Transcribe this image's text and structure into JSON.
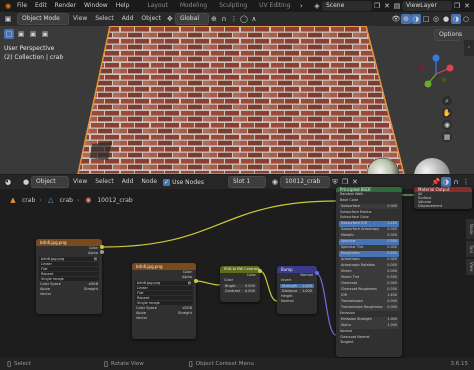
{
  "menubar": {
    "items": [
      "File",
      "Edit",
      "Render",
      "Window",
      "Help"
    ],
    "workspace_tabs": [
      "Layout",
      "Modeling",
      "Sculpting",
      "UV Editing"
    ],
    "active_tab_index": 3,
    "scene": "Scene",
    "view_layer": "ViewLayer"
  },
  "viewport": {
    "mode": "Object Mode",
    "menu": [
      "View",
      "Select",
      "Add",
      "Object"
    ],
    "orientation": "Global",
    "options_label": "Options",
    "overlay_line1": "User Perspective",
    "overlay_line2": "(2) Collection | crab"
  },
  "node_editor": {
    "editor_type": "Object",
    "menu": [
      "View",
      "Select",
      "Add",
      "Node"
    ],
    "use_nodes_label": "Use Nodes",
    "use_nodes": true,
    "slot": "Slot 1",
    "material": "10012_crab",
    "breadcrumb": [
      "crab",
      "crab",
      "10012_crab"
    ]
  },
  "nodes": {
    "tex1": {
      "title": "bdn6.jpg.png",
      "outputs": [
        "Color",
        "Alpha"
      ],
      "image_name": "bdn6.jpg.png",
      "fields": [
        "Linear",
        "Flat",
        "Repeat",
        "Single Image"
      ],
      "color_space_label": "Color Space",
      "color_space": "sRGB",
      "alpha_label": "Alpha",
      "alpha": "Straight",
      "vector_label": "Vector"
    },
    "tex2": {
      "title": "bdn6.jpg.png",
      "outputs": [
        "Color",
        "Alpha"
      ],
      "image_name": "bdn6.jpg.png",
      "fields": [
        "Linear",
        "Flat",
        "Repeat",
        "Single Image"
      ],
      "color_space_label": "Color Space",
      "color_space": "sRGB",
      "alpha_label": "Alpha",
      "alpha": "Straight",
      "vector_label": "Vector"
    },
    "rgb2bw": {
      "title": "RGB to BW Contrast",
      "output": "Color",
      "input": "Color",
      "bright_label": "Bright",
      "bright": "0.000",
      "contrast_label": "Contrast",
      "contrast": "0.000"
    },
    "bump": {
      "title": "Bump",
      "output": "Normal",
      "invert_label": "Invert",
      "strength_label": "Strength",
      "strength": "1.000",
      "distance_label": "Distance",
      "distance": "1.000",
      "height_label": "Height",
      "normal_label": "Normal"
    },
    "bsdf": {
      "title": "Principled BSDF",
      "rows": [
        {
          "label": "Random Walk",
          "value": ""
        },
        {
          "label": "Base Color",
          "value": ""
        },
        {
          "label": "Subsurface",
          "value": "0.000"
        },
        {
          "label": "Subsurface Radius",
          "value": ""
        },
        {
          "label": "Subsurface Color",
          "value": ""
        },
        {
          "label": "Subsurface IOR",
          "value": "1.400"
        },
        {
          "label": "Subsurface Anisotropy",
          "value": "0.000"
        },
        {
          "label": "Metallic",
          "value": "0.000"
        },
        {
          "label": "Specular",
          "value": "0.500"
        },
        {
          "label": "Specular Tint",
          "value": "0.000"
        },
        {
          "label": "Roughness",
          "value": "0.500"
        },
        {
          "label": "Anisotropic",
          "value": "0.000"
        },
        {
          "label": "Anisotropic Rotation",
          "value": "0.000"
        },
        {
          "label": "Sheen",
          "value": "0.000"
        },
        {
          "label": "Sheen Tint",
          "value": "0.500"
        },
        {
          "label": "Clearcoat",
          "value": "0.000"
        },
        {
          "label": "Clearcoat Roughness",
          "value": "0.030"
        },
        {
          "label": "IOR",
          "value": "1.450"
        },
        {
          "label": "Transmission",
          "value": "0.000"
        },
        {
          "label": "Transmission Roughness",
          "value": "0.000"
        },
        {
          "label": "Emission",
          "value": ""
        },
        {
          "label": "Emission Strength",
          "value": "1.000"
        },
        {
          "label": "Alpha",
          "value": "1.000"
        },
        {
          "label": "Normal",
          "value": ""
        },
        {
          "label": "Clearcoat Normal",
          "value": ""
        },
        {
          "label": "Tangent",
          "value": ""
        }
      ]
    },
    "output": {
      "title": "Material Output",
      "outputs": [
        "All",
        "Surface",
        "Volume",
        "Displacement"
      ]
    }
  },
  "statusbar": {
    "select": "Select",
    "rotate": "Rotate View",
    "context_menu": "Object Context Menu",
    "version": "3.6.15"
  },
  "colors": {
    "texture_header": "#7a4a1a",
    "vector_header": "#3a3a8a",
    "converter_header": "#5c6d1c",
    "shader_header": "#2f6b3a",
    "link": "#c9c93a",
    "accent_blue": "#4772b3"
  }
}
